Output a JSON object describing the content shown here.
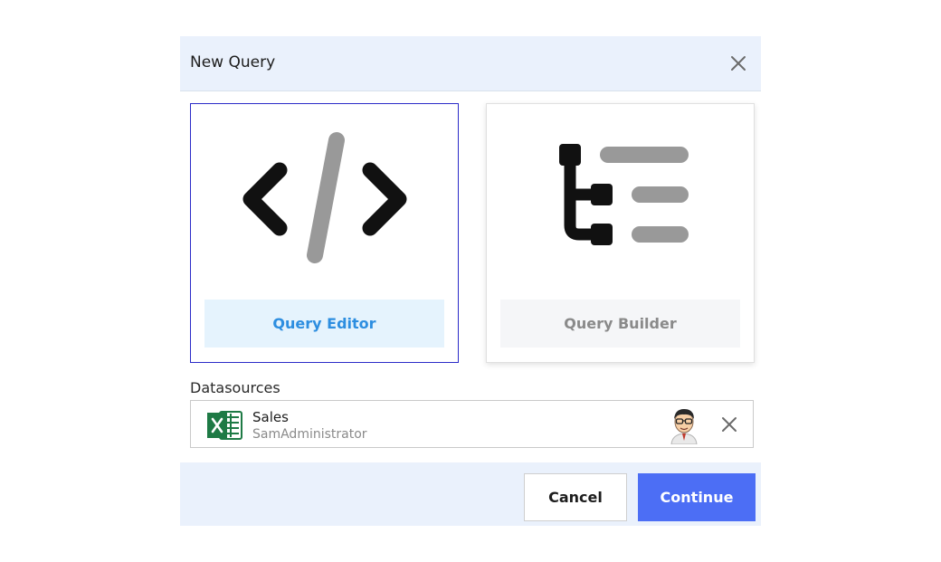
{
  "dialog": {
    "title": "New Query",
    "close_icon": "close-icon"
  },
  "options": [
    {
      "label": "Query Editor",
      "icon": "code-icon",
      "selected": true
    },
    {
      "label": "Query Builder",
      "icon": "tree-list-icon",
      "selected": false
    }
  ],
  "datasources": {
    "label": "Datasources",
    "items": [
      {
        "name": "Sales",
        "owner": "SamAdministrator",
        "type_icon": "excel-icon",
        "avatar": "user-avatar",
        "remove_icon": "close-icon"
      }
    ]
  },
  "footer": {
    "cancel_label": "Cancel",
    "continue_label": "Continue"
  },
  "colors": {
    "accent": "#4c6ef5",
    "selected_border": "#2b2bc8",
    "selected_label": "#2d8ee0",
    "header_bg": "#eaf1fc",
    "excel_green": "#1e7a45"
  }
}
